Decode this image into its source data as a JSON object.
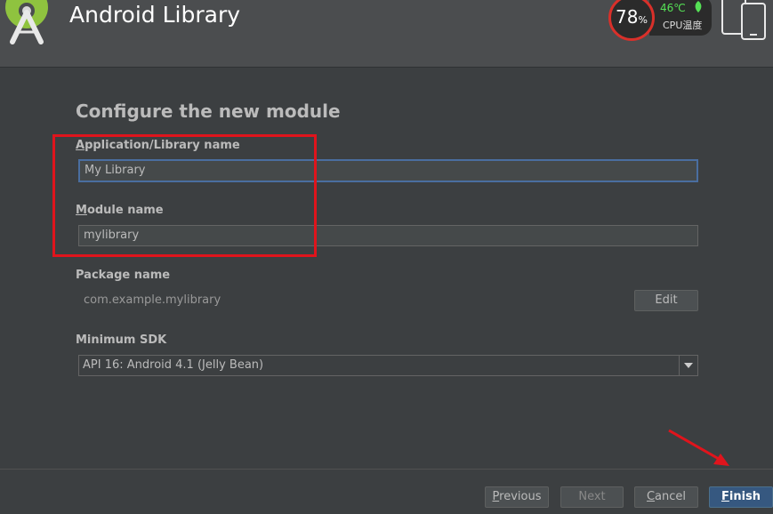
{
  "header": {
    "title": "Android Library",
    "cpu": {
      "percent": "78",
      "percent_unit": "%",
      "temperature": "46℃",
      "label": "CPU温度"
    }
  },
  "form": {
    "section_title": "Configure the new module",
    "app_name": {
      "label_mnemonic": "A",
      "label_rest": "pplication/Library name",
      "value": "My Library"
    },
    "module_name": {
      "label_mnemonic": "M",
      "label_rest": "odule name",
      "value": "mylibrary"
    },
    "package_name": {
      "label": "Package name",
      "value": "com.example.mylibrary",
      "edit_label": "Edit"
    },
    "min_sdk": {
      "label": "Minimum SDK",
      "selected": "API 16: Android 4.1 (Jelly Bean)"
    }
  },
  "footer": {
    "previous": {
      "mnemonic": "P",
      "rest": "revious"
    },
    "next": "Next",
    "cancel": {
      "mnemonic": "C",
      "rest": "ancel"
    },
    "finish": {
      "mnemonic": "F",
      "rest": "inish"
    }
  },
  "colors": {
    "background": "#3c3f41",
    "header": "#4b4d4f",
    "accent": "#365880",
    "annotation": "#e0141c"
  }
}
